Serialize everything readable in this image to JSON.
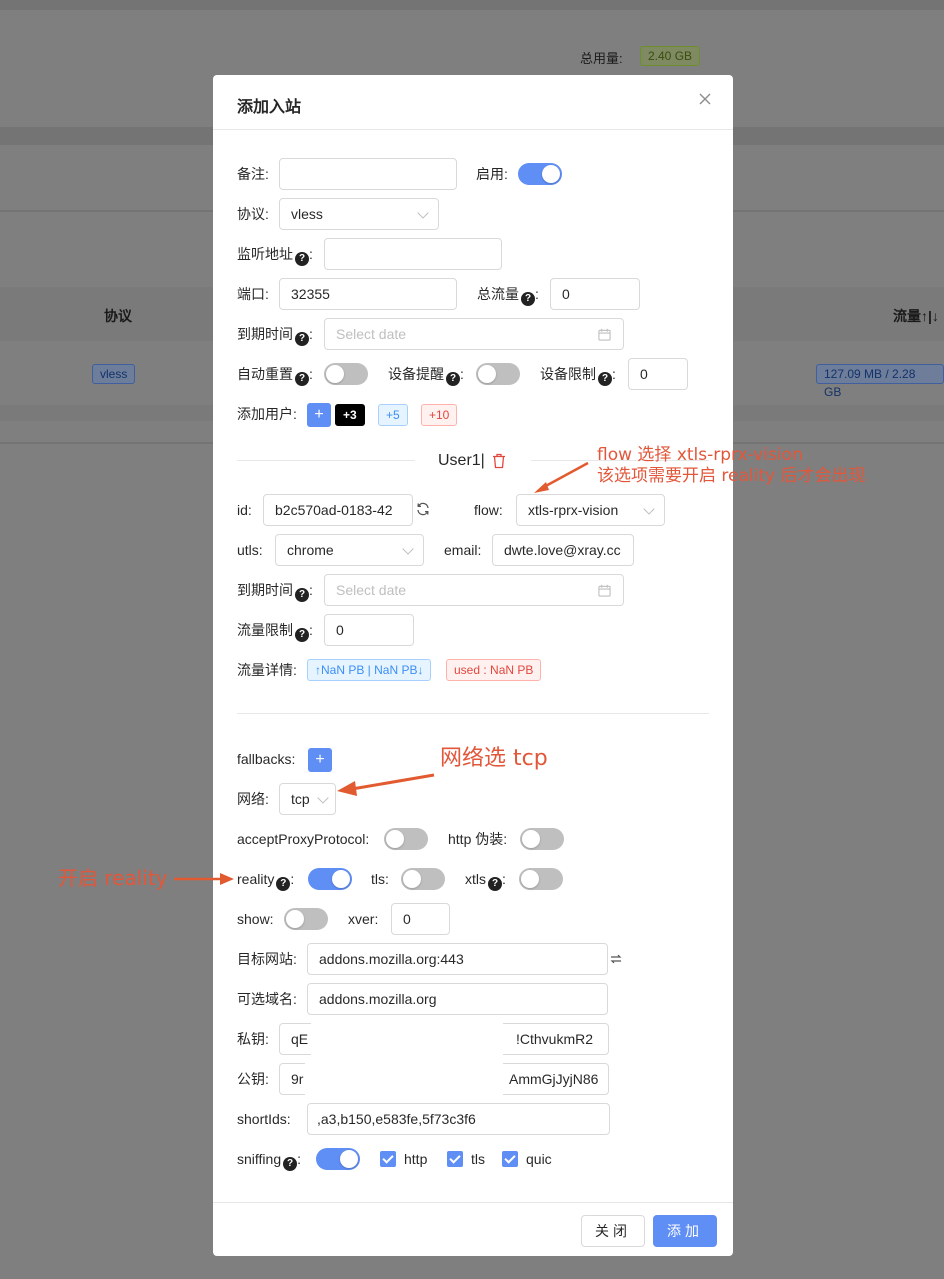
{
  "background": {
    "total_usage_label": "总用量:",
    "total_usage_value": "2.40 GB",
    "col_protocol": "协议",
    "col_traffic": "流量↑|↓",
    "row_protocol": "vless",
    "row_traffic": "127.09 MB / 2.28 GB"
  },
  "modal": {
    "title": "添加入站",
    "fields": {
      "remark_label": "备注:",
      "remark_value": "",
      "enable_label": "启用:",
      "protocol_label": "协议:",
      "protocol_value": "vless",
      "listen_label": "监听地址",
      "listen_value": "",
      "port_label": "端口:",
      "port_value": "32355",
      "total_traffic_label": "总流量",
      "total_traffic_value": "0",
      "expiry_label": "到期时间",
      "expiry_placeholder": "Select date",
      "auto_reset_label": "自动重置",
      "device_alert_label": "设备提醒",
      "device_limit_label": "设备限制",
      "device_limit_value": "0",
      "add_user_label": "添加用户:",
      "add_plus": "+",
      "tag_plus3": "+3",
      "tag_plus5": "+5",
      "tag_plus10": "+10"
    },
    "user": {
      "title": "User1|",
      "id_label": "id:",
      "id_value": "b2c570ad-0183-42",
      "flow_label": "flow:",
      "flow_value": "xtls-rprx-vision",
      "utls_label": "utls:",
      "utls_value": "chrome",
      "email_label": "email:",
      "email_value": "dwte.love@xray.cc",
      "expiry_label": "到期时间",
      "expiry_placeholder": "Select date",
      "traffic_limit_label": "流量限制",
      "traffic_limit_value": "0",
      "traffic_detail_label": "流量详情:",
      "traffic_tag": "↑NaN PB | NaN PB↓",
      "used_tag": "used : NaN PB"
    },
    "transport": {
      "fallbacks_label": "fallbacks:",
      "fallbacks_plus": "+",
      "network_label": "网络:",
      "network_value": "tcp",
      "accept_proxy_label": "acceptProxyProtocol:",
      "http_disguise_label": "http 伪装:",
      "reality_label": "reality",
      "tls_label": "tls:",
      "xtls_label": "xtls",
      "show_label": "show:",
      "xver_label": "xver:",
      "xver_value": "0",
      "dest_label": "目标网站:",
      "dest_value": "addons.mozilla.org:443",
      "server_names_label": "可选域名:",
      "server_names_value": "addons.mozilla.org",
      "private_key_label": "私钥:",
      "private_key_head": "qE",
      "private_key_tail": "!CthvukmR2",
      "public_key_label": "公钥:",
      "public_key_head": "9r",
      "public_key_tail": "AmmGjJyjN86",
      "short_ids_label": "shortIds:",
      "short_ids_value": ",a3,b150,e583fe,5f73c3f6",
      "sniffing_label": "sniffing",
      "sniff_http": "http",
      "sniff_tls": "tls",
      "sniff_quic": "quic"
    },
    "footer": {
      "close_label": "关闭",
      "add_label": "添加"
    }
  },
  "annotations": {
    "flow_line1": "flow 选择 xtls-rprx-vision",
    "flow_line2": "该选项需要开启 reality 后才会出现",
    "network_note": "网络选 tcp",
    "reality_note": "开启 reality"
  },
  "colors": {
    "primary": "#5f8ef5",
    "annotation": "#e2573a"
  }
}
